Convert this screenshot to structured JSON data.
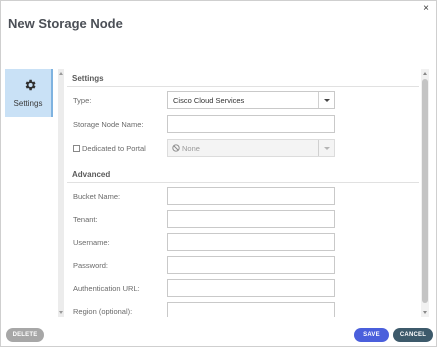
{
  "dialog": {
    "title": "New Storage Node",
    "close_glyph": "×"
  },
  "sidebar": {
    "items": [
      {
        "label": "Settings",
        "icon": "gear-icon",
        "active": true
      }
    ]
  },
  "sections": {
    "settings": {
      "heading": "Settings",
      "type_label": "Type:",
      "type_value": "Cisco Cloud Services",
      "storage_node_name_label": "Storage Node Name:",
      "storage_node_name_value": "",
      "dedicated_label": "Dedicated to Portal",
      "dedicated_checked": false,
      "portal_value": "None"
    },
    "advanced": {
      "heading": "Advanced",
      "fields": [
        {
          "label": "Bucket Name:",
          "value": ""
        },
        {
          "label": "Tenant:",
          "value": ""
        },
        {
          "label": "Username:",
          "value": ""
        },
        {
          "label": "Password:",
          "value": ""
        },
        {
          "label": "Authentication URL:",
          "value": ""
        },
        {
          "label": "Region (optional):",
          "value": ""
        }
      ]
    }
  },
  "footer": {
    "delete_label": "DELETE",
    "save_label": "SAVE",
    "cancel_label": "CANCEL"
  },
  "colors": {
    "accent": "#4a5fdc",
    "cancel": "#3d5a6b",
    "disabled": "#a7a7a7",
    "tab_active_bg": "#c9e1f6"
  }
}
